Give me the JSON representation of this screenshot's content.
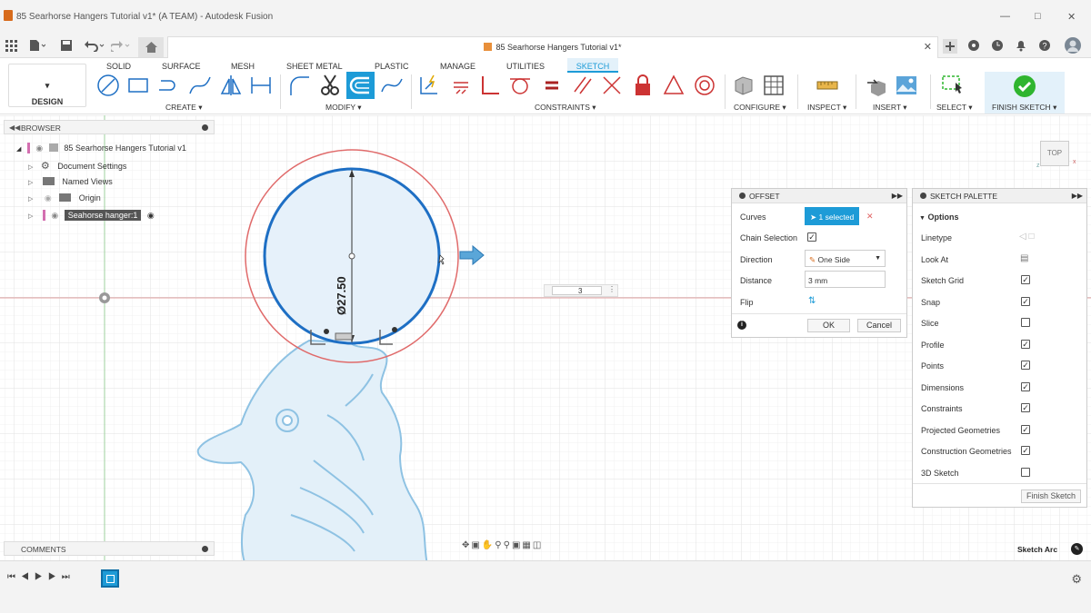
{
  "window": {
    "title": "85 Searhorse Hangers Tutorial v1* (A TEAM) - Autodesk Fusion"
  },
  "doc_tab": {
    "label": "85 Searhorse Hangers Tutorial v1*"
  },
  "workspace": {
    "label": "DESIGN"
  },
  "tabs": [
    "SOLID",
    "SURFACE",
    "MESH",
    "SHEET METAL",
    "PLASTIC",
    "MANAGE",
    "UTILITIES",
    "SKETCH"
  ],
  "groups": {
    "create": "CREATE",
    "modify": "MODIFY",
    "constraints": "CONSTRAINTS",
    "configure": "CONFIGURE",
    "inspect": "INSPECT",
    "insert": "INSERT",
    "select": "SELECT",
    "finish": "FINISH SKETCH"
  },
  "browser": {
    "title": "BROWSER",
    "root": "85 Searhorse Hangers Tutorial v1",
    "items": [
      "Document Settings",
      "Named Views",
      "Origin",
      "Seahorse hanger:1"
    ]
  },
  "comments": {
    "title": "COMMENTS"
  },
  "dimension": {
    "label": "Ø27.50"
  },
  "offset_input": {
    "value": "3"
  },
  "viewcube": {
    "label": "TOP"
  },
  "offset": {
    "title": "OFFSET",
    "curves_label": "Curves",
    "curves_value": "1 selected",
    "chain_label": "Chain Selection",
    "direction_label": "Direction",
    "direction_value": "One Side",
    "distance_label": "Distance",
    "distance_value": "3 mm",
    "flip_label": "Flip",
    "ok": "OK",
    "cancel": "Cancel"
  },
  "palette": {
    "title": "SKETCH PALETTE",
    "section": "Options",
    "linetype": "Linetype",
    "look_at": "Look At",
    "options": [
      {
        "label": "Sketch Grid",
        "checked": true
      },
      {
        "label": "Snap",
        "checked": true
      },
      {
        "label": "Slice",
        "checked": false
      },
      {
        "label": "Profile",
        "checked": true
      },
      {
        "label": "Points",
        "checked": true
      },
      {
        "label": "Dimensions",
        "checked": true
      },
      {
        "label": "Constraints",
        "checked": true
      },
      {
        "label": "Projected Geometries",
        "checked": true
      },
      {
        "label": "Construction Geometries",
        "checked": true
      },
      {
        "label": "3D Sketch",
        "checked": false
      }
    ],
    "finish": "Finish Sketch"
  },
  "status": {
    "label": "Sketch Arc"
  },
  "colors": {
    "accent": "#1d9bd7",
    "sketch_blue": "#1e6fc4",
    "offset_red": "#e06a6a",
    "finish_green": "#2fb52f"
  }
}
